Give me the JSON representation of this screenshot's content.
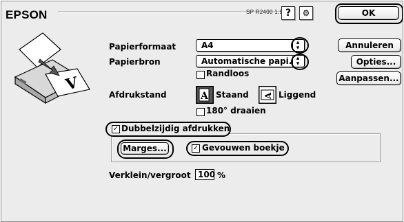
{
  "header": {
    "brand": "EPSON",
    "model": "SP R2400 1.91D",
    "help_icon_glyph": "?",
    "tool_icon_glyph": "⚙"
  },
  "buttons": {
    "ok": "OK",
    "annuleren": "Annuleren",
    "opties": "Opties...",
    "aanpassen": "Aanpassen..."
  },
  "papier": {
    "formaat_label": "Papierformaat",
    "formaat_value": "A4",
    "bron_label": "Papierbron",
    "bron_value": "Automatische papi...",
    "randloos_label": "Randloos",
    "randloos_checked": false
  },
  "orientation": {
    "label": "Afdrukstand",
    "staand_label": "Staand",
    "liggend_label": "Liggend",
    "selected": "staand",
    "rotate_label": "180° draaien",
    "rotate_checked": false
  },
  "duplex": {
    "label": "Dubbelzijdig afdrukken",
    "checked": true,
    "marges_label": "Marges...",
    "boekje_label": "Gevouwen boekje",
    "boekje_checked": true
  },
  "scale": {
    "label": "Verklein/vergroot",
    "value": "100",
    "unit": "%"
  },
  "icons": [
    "printer-illustration-icon",
    "help-icon",
    "tool-icon",
    "popup-arrows-icon",
    "portrait-icon",
    "landscape-icon",
    "checkmark-icon"
  ]
}
